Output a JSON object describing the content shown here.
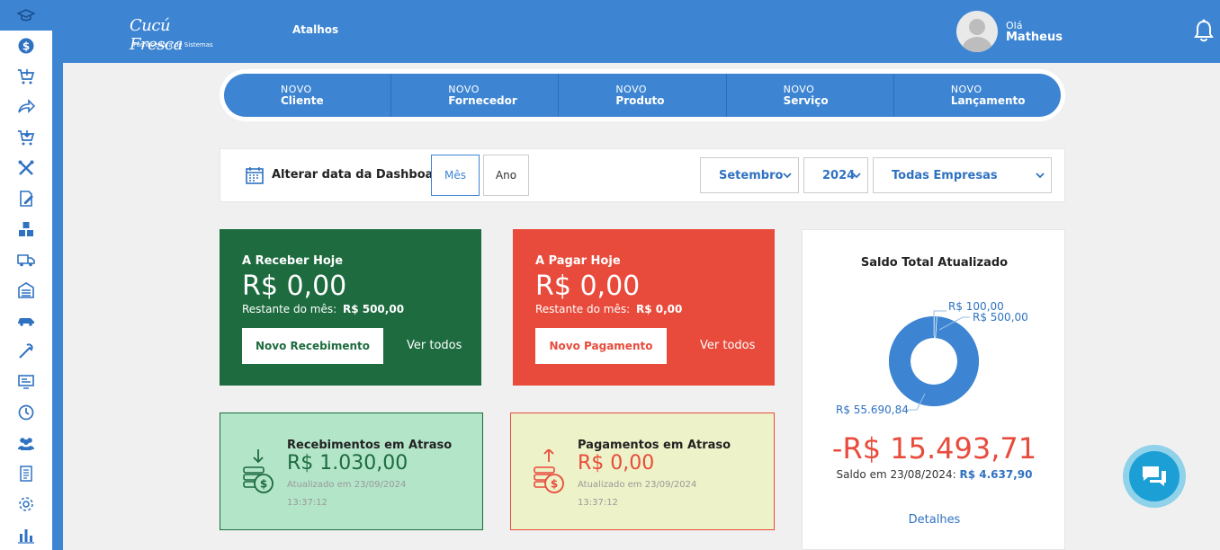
{
  "topbar": {
    "logo_text": "Cucú Fresca",
    "logo_sub": "Fornecedora de Sistemas",
    "atalhos": "Atalhos",
    "greeting": "Olá",
    "user_name": "Matheus"
  },
  "sidebar": {
    "items": [
      {
        "icon": "graduation-cap-icon"
      },
      {
        "icon": "dollar-icon"
      },
      {
        "icon": "cart-icon"
      },
      {
        "icon": "share-icon"
      },
      {
        "icon": "cart-down-icon"
      },
      {
        "icon": "tools-icon"
      },
      {
        "icon": "edit-document-icon"
      },
      {
        "icon": "boxes-icon"
      },
      {
        "icon": "truck-icon"
      },
      {
        "icon": "warehouse-icon"
      },
      {
        "icon": "car-icon"
      },
      {
        "icon": "wrench-icon"
      },
      {
        "icon": "monitor-icon"
      },
      {
        "icon": "history-icon"
      },
      {
        "icon": "users-icon"
      },
      {
        "icon": "report-icon"
      },
      {
        "icon": "gear-icon"
      },
      {
        "icon": "chart-icon"
      }
    ]
  },
  "quick": {
    "items": [
      {
        "top": "NOVO",
        "label": "Cliente"
      },
      {
        "top": "NOVO",
        "label": "Fornecedor"
      },
      {
        "top": "NOVO",
        "label": "Produto"
      },
      {
        "top": "NOVO",
        "label": "Serviço"
      },
      {
        "top": "NOVO",
        "label": "Lançamento"
      }
    ]
  },
  "datebar": {
    "label": "Alterar data da Dashboard",
    "btn_mes": "Mês",
    "btn_ano": "Ano",
    "month": "Setembro",
    "year": "2024",
    "company": "Todas Empresas"
  },
  "receber": {
    "title": "A Receber Hoje",
    "amount": "R$ 0,00",
    "rest_label": "Restante do mês:",
    "rest_value": "R$ 500,00",
    "button": "Novo Recebimento",
    "link": "Ver todos"
  },
  "pagar": {
    "title": "A Pagar Hoje",
    "amount": "R$ 0,00",
    "rest_label": "Restante do mês:",
    "rest_value": "R$ 0,00",
    "button": "Novo Pagamento",
    "link": "Ver todos"
  },
  "rec_atraso": {
    "title": "Recebimentos em Atraso",
    "amount": "R$ 1.030,00",
    "updated": "Atualizado em 23/09/2024 13:37:12"
  },
  "pag_atraso": {
    "title": "Pagamentos em Atraso",
    "amount": "R$ 0,00",
    "updated": "Atualizado em 23/09/2024 13:37:12"
  },
  "saldo": {
    "title": "Saldo Total Atualizado",
    "labels": [
      "R$ 100,00",
      "R$ 500,00",
      "R$ 55.690,84"
    ],
    "big": "-R$ 15.493,71",
    "sub_label": "Saldo em 23/08/2024:",
    "sub_value": "R$ 4.637,90",
    "details": "Detalhes"
  },
  "chart_data": {
    "type": "pie",
    "categories": [
      "R$ 100,00",
      "R$ 500,00",
      "R$ 55.690,84"
    ],
    "values": [
      100,
      500,
      55690.84
    ],
    "title": "Saldo Total Atualizado"
  },
  "colors": {
    "primary": "#3d85d2",
    "green": "#1d6b3f",
    "red": "#e84b3c"
  }
}
